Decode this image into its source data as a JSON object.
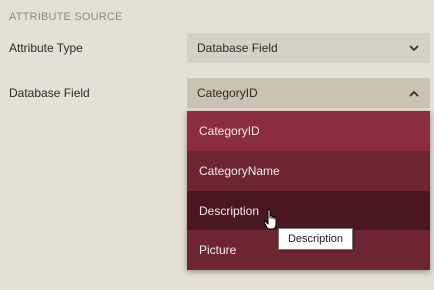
{
  "section": {
    "header": "ATTRIBUTE SOURCE"
  },
  "attribute_type": {
    "label": "Attribute Type",
    "value": "Database Field",
    "icon": "chevron-down-icon"
  },
  "database_field": {
    "label": "Database Field",
    "value": "CategoryID",
    "icon": "chevron-up-icon",
    "options": [
      {
        "label": "CategoryID",
        "state": "selected"
      },
      {
        "label": "CategoryName",
        "state": "normal"
      },
      {
        "label": "Description",
        "state": "hover"
      },
      {
        "label": "Picture",
        "state": "normal"
      }
    ]
  },
  "tooltip": {
    "text": "Description"
  },
  "colors": {
    "background": "#e5e0d6",
    "option_selected": "#8c2c3f",
    "option_normal": "#6e2532",
    "option_hover": "#4a1720"
  }
}
